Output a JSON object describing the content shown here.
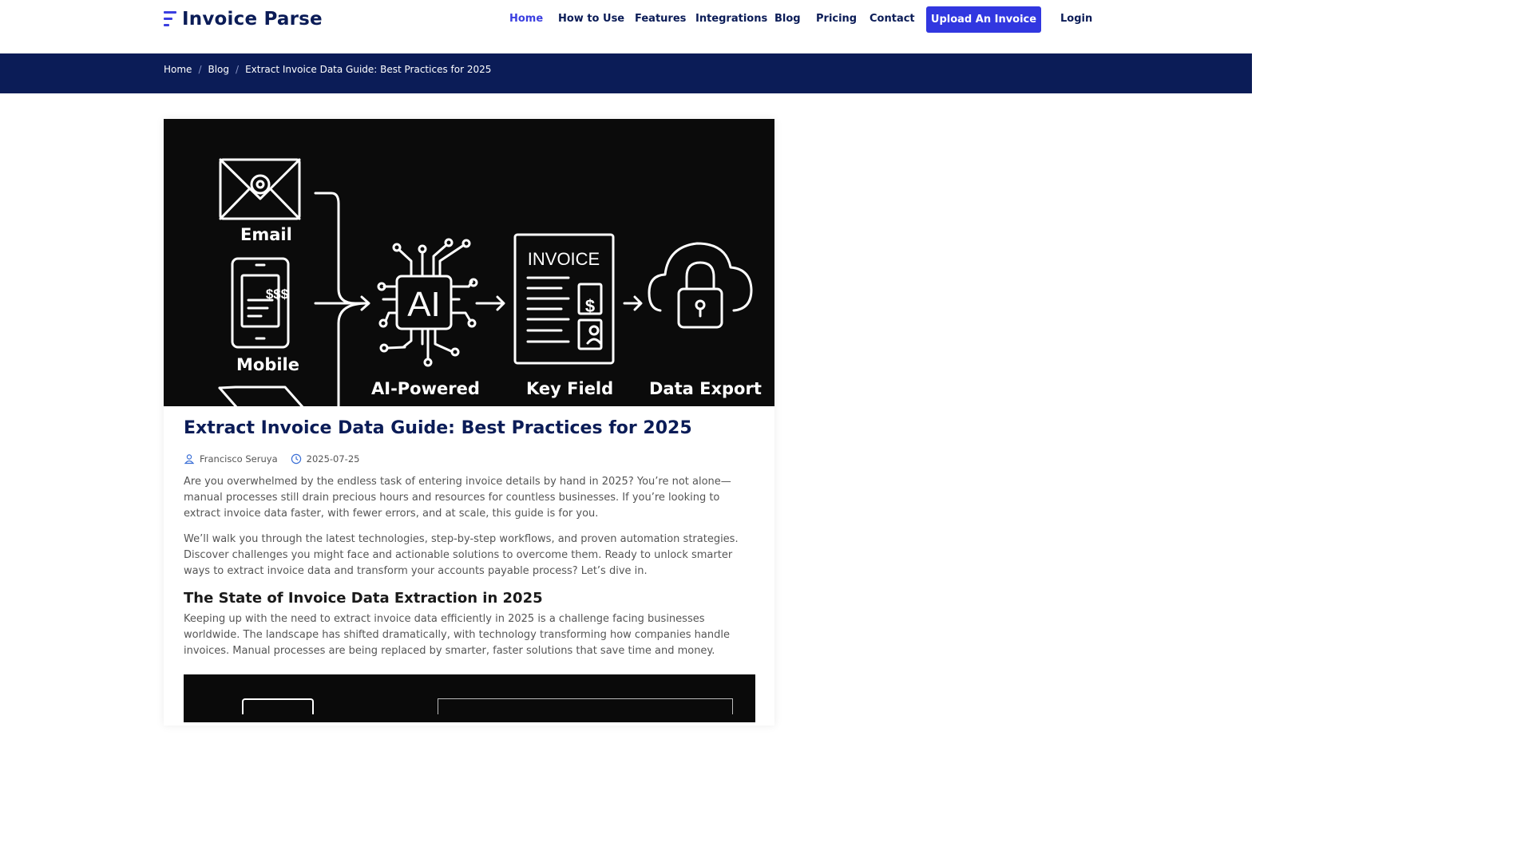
{
  "brand": {
    "name": "Invoice Parse"
  },
  "nav": {
    "items": [
      "Home",
      "How to Use",
      "Features",
      "Integrations",
      "Blog",
      "Pricing",
      "Contact"
    ],
    "upload_label": "Upload An Invoice",
    "login_label": "Login"
  },
  "breadcrumb": {
    "items": [
      "Home",
      "Blog",
      "Extract Invoice Data Guide: Best Practices for 2025"
    ],
    "separator": "/"
  },
  "hero": {
    "labels": {
      "email": "Email",
      "mobile": "Mobile",
      "ai_chip": "AI",
      "ai_powered": "AI-Powered",
      "invoice": "INVOICE",
      "key_field": "Key Field",
      "data_export": "Data Export",
      "dollars": "$$$"
    }
  },
  "article": {
    "title": "Extract Invoice Data Guide: Best Practices for 2025",
    "author": "Francisco Seruya",
    "date": "2025-07-25",
    "paragraphs": [
      "Are you overwhelmed by the endless task of entering invoice details by hand in 2025? You’re not alone—manual processes still drain precious hours and resources for countless businesses. If you’re looking to extract invoice data faster, with fewer errors, and at scale, this guide is for you.",
      "We’ll walk you through the latest technologies, step-by-step workflows, and proven automation strategies. Discover challenges you might face and actionable solutions to overcome them. Ready to unlock smarter ways to extract invoice data and transform your accounts payable process? Let’s dive in."
    ],
    "section_heading": "The State of Invoice Data Extraction in 2025",
    "section_paragraph": "Keeping up with the need to extract invoice data efficiently in 2025 is a challenge facing businesses worldwide. The landscape has shifted dramatically, with technology transforming how companies handle invoices. Manual processes are being replaced by smarter, faster solutions that save time and money."
  },
  "colors": {
    "navy": "#0b1c57",
    "accent": "#3137e0",
    "hero_bg": "#0b0b0b"
  }
}
